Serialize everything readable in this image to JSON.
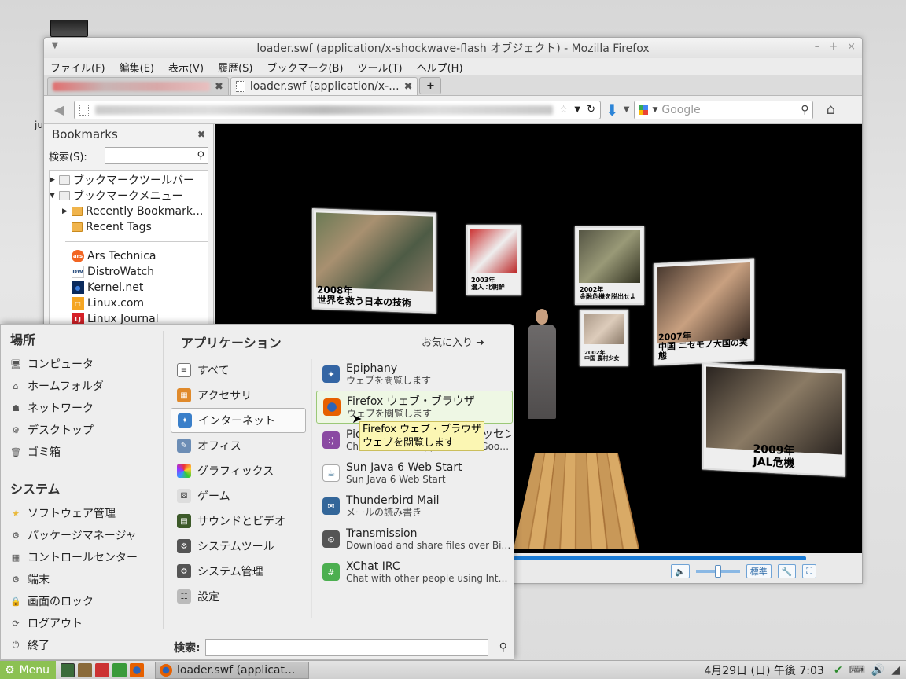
{
  "desktop": {
    "label": "ju"
  },
  "firefox": {
    "title": "loader.swf (application/x-shockwave-flash オブジェクト) - Mozilla Firefox",
    "wm_buttons": [
      "–",
      "+",
      "×"
    ],
    "menus": [
      "ファイル(F)",
      "編集(E)",
      "表示(V)",
      "履歴(S)",
      "ブックマーク(B)",
      "ツール(T)",
      "ヘルプ(H)"
    ],
    "tabs": [
      {
        "label": "",
        "close": "✖"
      },
      {
        "label": "loader.swf (application/x-...",
        "close": "✖"
      }
    ],
    "newtab": "+",
    "search_placeholder": "Google",
    "bookmarks": {
      "title": "Bookmarks",
      "close": "✖",
      "search_label": "検索(S):",
      "tree": [
        {
          "label": "ブックマークツールバー"
        },
        {
          "label": "ブックマークメニュー"
        },
        {
          "label": "Recently Bookmark..."
        },
        {
          "label": "Recent Tags"
        }
      ],
      "links": [
        {
          "label": "Ars Technica",
          "icon": "ars",
          "color": "#f26522"
        },
        {
          "label": "DistroWatch",
          "icon": "DW",
          "color": "#2b4f7e"
        },
        {
          "label": "Kernel.net",
          "icon": "●",
          "color": "#0a2a5c"
        },
        {
          "label": "Linux.com",
          "icon": "□",
          "color": "#f5a623"
        },
        {
          "label": "Linux Journal",
          "icon": "LJ",
          "color": "#d62027"
        }
      ]
    },
    "video": {
      "captions": [
        "2008年\n世界を救う日本の技術",
        "2003年\n潜入 北朝鮮",
        "2002年\n金融危機を脱出せよ",
        "2002年\n中国 農村少女",
        "2007年\n中国 ニセモノ大国の実態",
        "2009年\nJAL危機"
      ]
    },
    "player": {
      "quality_label": "標準"
    }
  },
  "menu": {
    "places_title": "場所",
    "places": [
      "コンピュータ",
      "ホームフォルダ",
      "ネットワーク",
      "デスクトップ",
      "ゴミ箱"
    ],
    "system_title": "システム",
    "system": [
      "ソフトウェア管理",
      "パッケージマネージャ",
      "コントロールセンター",
      "端末",
      "画面のロック",
      "ログアウト",
      "終了"
    ],
    "apps_title": "アプリケーション",
    "favorites": "お気に入り",
    "categories": [
      "すべて",
      "アクセサリ",
      "インターネット",
      "オフィス",
      "グラフィックス",
      "ゲーム",
      "サウンドとビデオ",
      "システムツール",
      "システム管理",
      "設定"
    ],
    "apps": [
      {
        "name": "Epiphany",
        "desc": "ウェブを閲覧します",
        "color": "#3465a4"
      },
      {
        "name": "Firefox ウェブ・ブラウザ",
        "desc": "ウェブを閲覧します",
        "color": "#e66000"
      },
      {
        "name": "Pidgin インターネット・メッセンジャー",
        "desc": "Chat over IM. Supports AIM, Google Talk",
        "color": "#8a4aa2"
      },
      {
        "name": "Sun Java 6 Web Start",
        "desc": "Sun Java 6 Web Start",
        "color": "#5382a1"
      },
      {
        "name": "Thunderbird Mail",
        "desc": "メールの読み書き",
        "color": "#336699"
      },
      {
        "name": "Transmission",
        "desc": "Download and share files over BitTorrent",
        "color": "#555555"
      },
      {
        "name": "XChat IRC",
        "desc": "Chat with other people using Internet Relay Chat",
        "color": "#4caf50"
      }
    ],
    "search_label": "検索:",
    "tooltip_line1": "Firefox ウェブ・ブラウザ",
    "tooltip_line2": "ウェブを閲覧します"
  },
  "taskbar": {
    "menu_label": "Menu",
    "window_label": "loader.swf (applicat...",
    "clock": "4月29日 (日) 午後 7:03"
  }
}
